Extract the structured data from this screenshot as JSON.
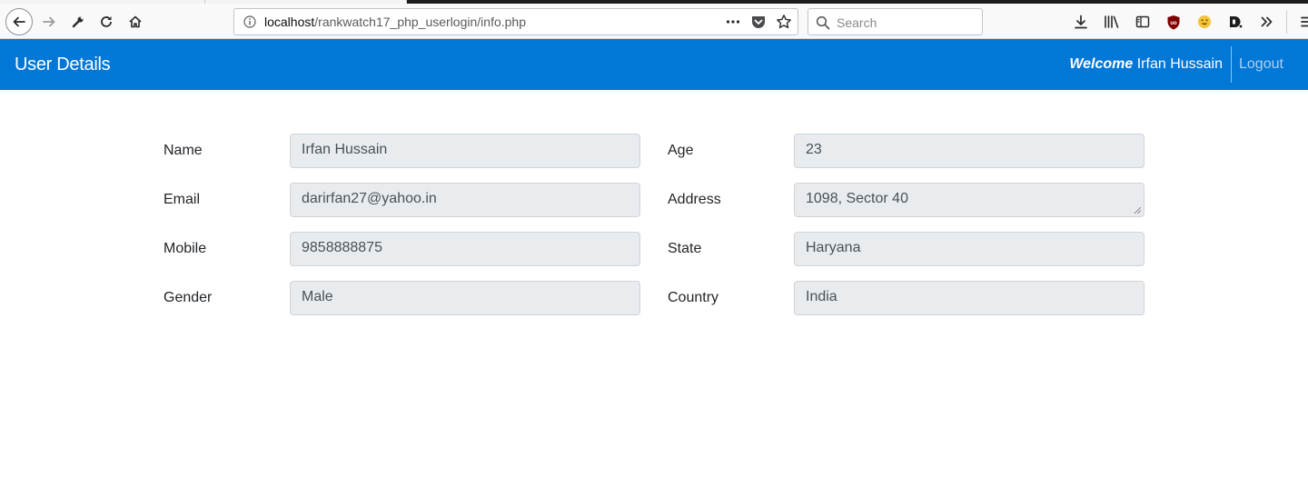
{
  "browser": {
    "url_host": "localhost",
    "url_path": "/rankwatch17_php_userlogin/info.php",
    "search_placeholder": "Search",
    "icons": [
      "back-icon",
      "forward-icon",
      "wrench-icon",
      "reload-icon",
      "home-icon",
      "info-icon",
      "more-icon",
      "pocket-icon",
      "bookmark-star-icon",
      "search-icon",
      "download-icon",
      "library-icon",
      "sidebar-icon",
      "ublock-icon",
      "emoji-icon",
      "dashlane-icon",
      "overflow-icon",
      "menu-icon"
    ]
  },
  "navbar": {
    "brand": "User Details",
    "welcome_prefix": "Welcome",
    "user_name": "Irfan Hussain",
    "logout": "Logout",
    "color": "#0177d7"
  },
  "fields": {
    "name": {
      "label": "Name",
      "value": "Irfan Hussain"
    },
    "email": {
      "label": "Email",
      "value": "darirfan27@yahoo.in"
    },
    "mobile": {
      "label": "Mobile",
      "value": "9858888875"
    },
    "gender": {
      "label": "Gender",
      "value": "Male"
    },
    "age": {
      "label": "Age",
      "value": "23"
    },
    "address": {
      "label": "Address",
      "value": "1098, Sector 40"
    },
    "state": {
      "label": "State",
      "value": "Haryana"
    },
    "country": {
      "label": "Country",
      "value": "India"
    }
  }
}
